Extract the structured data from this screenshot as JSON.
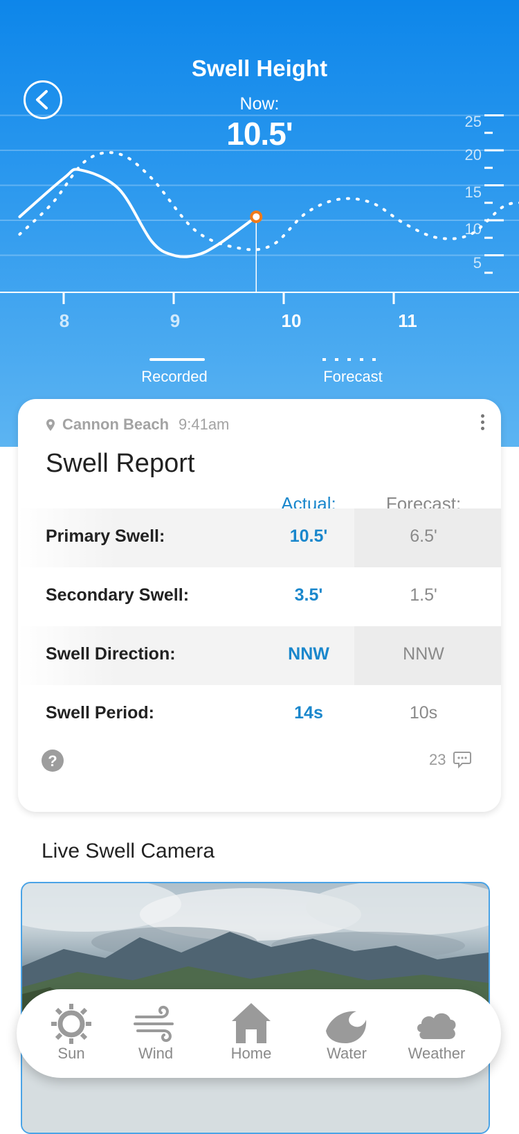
{
  "header": {
    "title": "Swell Height",
    "now_label": "Now:",
    "now_value": "10.5'"
  },
  "chart_data": {
    "type": "line",
    "x_ticks": [
      "8",
      "9",
      "10",
      "11"
    ],
    "y_ticks": [
      "25",
      "20",
      "15",
      "10",
      "5"
    ],
    "ylim": [
      0,
      25
    ],
    "current": {
      "x": 9.75,
      "y": 10.5
    },
    "series": [
      {
        "name": "Recorded",
        "style": "solid",
        "x": [
          7.6,
          8.0,
          8.15,
          8.5,
          8.8,
          9.0,
          9.2,
          9.4,
          9.75
        ],
        "y": [
          10.5,
          16.0,
          17.2,
          14.5,
          7.0,
          5.0,
          5.0,
          6.5,
          10.5
        ]
      },
      {
        "name": "Forecast",
        "style": "dotted",
        "x": [
          7.6,
          7.9,
          8.2,
          8.5,
          8.8,
          9.2,
          9.6,
          9.9,
          10.2,
          10.5,
          10.8,
          11.1,
          11.4,
          11.7,
          12.0,
          12.2
        ],
        "y": [
          8.0,
          12.5,
          18.5,
          19.5,
          16.0,
          8.5,
          6.0,
          6.5,
          11.0,
          13.0,
          12.5,
          9.5,
          7.5,
          8.0,
          12.0,
          12.5
        ]
      }
    ]
  },
  "legend": {
    "recorded": "Recorded",
    "forecast": "Forecast"
  },
  "report": {
    "location": "Cannon Beach",
    "time": "9:41am",
    "title": "Swell Report",
    "actual_header": "Actual:",
    "forecast_header": "Forecast:",
    "rows": [
      {
        "label": "Primary Swell:",
        "actual": "10.5'",
        "forecast": "6.5'"
      },
      {
        "label": "Secondary Swell:",
        "actual": "3.5'",
        "forecast": "1.5'"
      },
      {
        "label": "Swell Direction:",
        "actual": "NNW",
        "forecast": "NNW"
      },
      {
        "label": "Swell Period:",
        "actual": "14s",
        "forecast": "10s"
      }
    ],
    "help": "?",
    "comment_count": "23"
  },
  "camera": {
    "title": "Live Swell Camera"
  },
  "tabs": [
    {
      "label": "Sun",
      "icon": "sun-icon"
    },
    {
      "label": "Wind",
      "icon": "wind-icon"
    },
    {
      "label": "Home",
      "icon": "home-icon"
    },
    {
      "label": "Water",
      "icon": "wave-icon"
    },
    {
      "label": "Weather",
      "icon": "cloud-icon"
    }
  ],
  "colors": {
    "accent": "#1a87cc",
    "marker": "#f07a1a",
    "hero_top": "#0d86ea",
    "hero_bottom": "#5cb4f2"
  }
}
